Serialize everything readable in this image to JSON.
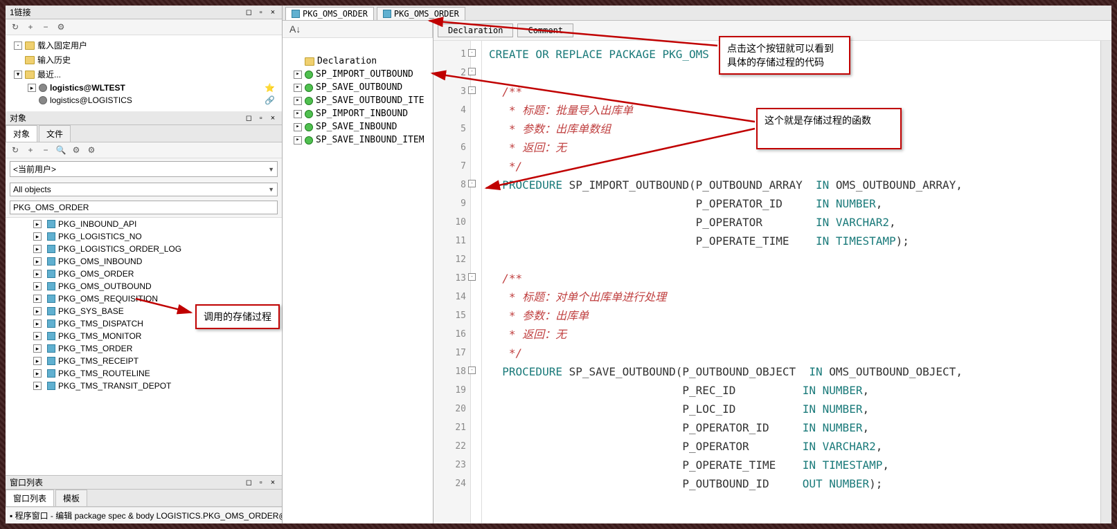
{
  "left": {
    "panel1_title": "1链接",
    "toolbar_icons": [
      "↻",
      "+",
      "−",
      "⚙"
    ],
    "tree": [
      {
        "label": "载入固定用户",
        "type": "folder",
        "indent": 0,
        "toggle": "-"
      },
      {
        "label": "输入历史",
        "type": "folder",
        "indent": 0,
        "toggle": ""
      },
      {
        "label": "最近...",
        "type": "folder",
        "indent": 0,
        "toggle": "▾"
      },
      {
        "label": "logistics@WLTEST",
        "type": "conn",
        "indent": 1,
        "toggle": "▸",
        "bold": true,
        "right": "star"
      },
      {
        "label": "logistics@LOGISTICS",
        "type": "conn",
        "indent": 1,
        "toggle": "",
        "right": "link"
      }
    ],
    "panel2_title": "对象",
    "tabs2": [
      "对象",
      "文件"
    ],
    "toolbar2_icons": [
      "↻",
      "+",
      "−",
      "🔍",
      "⚙",
      "⚙"
    ],
    "combo_user": "<当前用户>",
    "combo_objtype": "All objects",
    "filter_value": "PKG_OMS_ORDER",
    "packages": [
      "PKG_INBOUND_API",
      "PKG_LOGISTICS_NO",
      "PKG_LOGISTICS_ORDER_LOG",
      "PKG_OMS_INBOUND",
      "PKG_OMS_ORDER",
      "PKG_OMS_OUTBOUND",
      "PKG_OMS_REQUISITION",
      "PKG_SYS_BASE",
      "PKG_TMS_DISPATCH",
      "PKG_TMS_MONITOR",
      "PKG_TMS_ORDER",
      "PKG_TMS_RECEIPT",
      "PKG_TMS_ROUTELINE",
      "PKG_TMS_TRANSIT_DEPOT"
    ],
    "panel3_title": "窗口列表",
    "tabs3": [
      "窗口列表",
      "模板"
    ],
    "status": "程序窗口 - 编辑 package spec & body LOGISTICS.PKG_OMS_ORDER@WL"
  },
  "mid": {
    "decl_label": "Declaration",
    "procs": [
      "SP_IMPORT_OUTBOUND",
      "SP_SAVE_OUTBOUND",
      "SP_SAVE_OUTBOUND_ITE",
      "SP_IMPORT_INBOUND",
      "SP_SAVE_INBOUND",
      "SP_SAVE_INBOUND_ITEM"
    ]
  },
  "editor": {
    "tabs": [
      "PKG_OMS_ORDER",
      "PKG_OMS_ORDER"
    ],
    "btn_decl": "Declaration",
    "btn_comment": "Comment",
    "lines": [
      {
        "n": 1,
        "fold": "-",
        "t": "CREATE OR REPLACE PACKAGE PKG_OMS",
        "cls": "kw"
      },
      {
        "n": 2,
        "fold": "-",
        "t": ""
      },
      {
        "n": 3,
        "fold": "-",
        "t": "  /**",
        "cls": "cm"
      },
      {
        "n": 4,
        "t": "   * 标题：批量导入出库单",
        "cls": "cm"
      },
      {
        "n": 5,
        "t": "   * 参数：出库单数组",
        "cls": "cm"
      },
      {
        "n": 6,
        "t": "   * 返回：无",
        "cls": "cm"
      },
      {
        "n": 7,
        "t": "   */",
        "cls": "cm"
      },
      {
        "n": 8,
        "fold": "-",
        "t": "  PROCEDURE SP_IMPORT_OUTBOUND(P_OUTBOUND_ARRAY  IN OMS_OUTBOUND_ARRAY,",
        "mix": true
      },
      {
        "n": 9,
        "t": "                               P_OPERATOR_ID     IN NUMBER,",
        "mix": true
      },
      {
        "n": 10,
        "t": "                               P_OPERATOR        IN VARCHAR2,",
        "mix": true
      },
      {
        "n": 11,
        "t": "                               P_OPERATE_TIME    IN TIMESTAMP);",
        "mix": true
      },
      {
        "n": 12,
        "t": ""
      },
      {
        "n": 13,
        "fold": "-",
        "t": "  /**",
        "cls": "cm"
      },
      {
        "n": 14,
        "t": "   * 标题：对单个出库单进行处理",
        "cls": "cm"
      },
      {
        "n": 15,
        "t": "   * 参数：出库单",
        "cls": "cm"
      },
      {
        "n": 16,
        "t": "   * 返回：无",
        "cls": "cm"
      },
      {
        "n": 17,
        "t": "   */",
        "cls": "cm"
      },
      {
        "n": 18,
        "fold": "-",
        "t": "  PROCEDURE SP_SAVE_OUTBOUND(P_OUTBOUND_OBJECT  IN OMS_OUTBOUND_OBJECT,",
        "mix": true
      },
      {
        "n": 19,
        "t": "                             P_REC_ID          IN NUMBER,",
        "mix": true
      },
      {
        "n": 20,
        "t": "                             P_LOC_ID          IN NUMBER,",
        "mix": true
      },
      {
        "n": 21,
        "t": "                             P_OPERATOR_ID     IN NUMBER,",
        "mix": true
      },
      {
        "n": 22,
        "t": "                             P_OPERATOR        IN VARCHAR2,",
        "mix": true
      },
      {
        "n": 23,
        "t": "                             P_OPERATE_TIME    IN TIMESTAMP,",
        "mix": true
      },
      {
        "n": 24,
        "t": "                             P_OUTBOUND_ID     OUT NUMBER);",
        "mix": true
      }
    ]
  },
  "annotations": {
    "a1": "调用的存储过程",
    "a2": "点击这个按钮就可以看到具体的存储过程的代码",
    "a3": "这个就是存储过程的函数"
  }
}
